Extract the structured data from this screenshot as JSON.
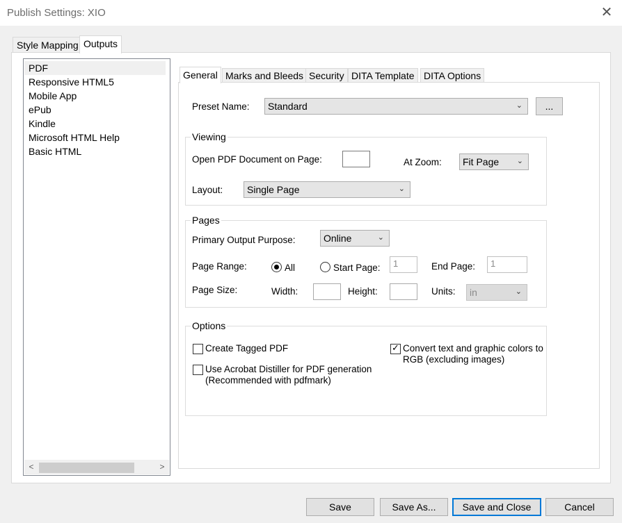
{
  "window": {
    "title": "Publish Settings: XIO"
  },
  "outer_tabs": [
    {
      "label": "Style Mapping"
    },
    {
      "label": "Outputs"
    }
  ],
  "output_list": [
    {
      "label": "PDF"
    },
    {
      "label": "Responsive HTML5"
    },
    {
      "label": "Mobile App"
    },
    {
      "label": "ePub"
    },
    {
      "label": "Kindle"
    },
    {
      "label": "Microsoft HTML Help"
    },
    {
      "label": "Basic HTML"
    }
  ],
  "inner_tabs": [
    {
      "label": "General"
    },
    {
      "label": "Marks and Bleeds"
    },
    {
      "label": "Security"
    },
    {
      "label": "DITA Template"
    },
    {
      "label": "DITA Options"
    }
  ],
  "general": {
    "preset_label": "Preset Name:",
    "preset_value": "Standard",
    "preset_browse": "...",
    "viewing": {
      "title": "Viewing",
      "open_page_label": "Open PDF Document on Page:",
      "open_page_value": "",
      "zoom_label": "At Zoom:",
      "zoom_value": "Fit Page",
      "layout_label": "Layout:",
      "layout_value": "Single Page"
    },
    "pages": {
      "title": "Pages",
      "purpose_label": "Primary Output Purpose:",
      "purpose_value": "Online",
      "range_label": "Page Range:",
      "range_all": "All",
      "range_start": "Start Page:",
      "start_value": "1",
      "end_label": "End Page:",
      "end_value": "1",
      "size_label": "Page Size:",
      "width_label": "Width:",
      "width_value": "",
      "height_label": "Height:",
      "height_value": "",
      "units_label": "Units:",
      "units_value": "in"
    },
    "options": {
      "title": "Options",
      "tagged_pdf": "Create Tagged PDF",
      "tagged_pdf_checked": false,
      "distiller_line1": "Use Acrobat Distiller for PDF generation",
      "distiller_line2": "(Recommended with pdfmark)",
      "distiller_checked": false,
      "rgb_line1": "Convert text and graphic colors to",
      "rgb_line2": "RGB (excluding images)",
      "rgb_checked": true
    }
  },
  "footer": {
    "save": "Save",
    "save_as": "Save As...",
    "save_close": "Save and Close",
    "cancel": "Cancel"
  }
}
